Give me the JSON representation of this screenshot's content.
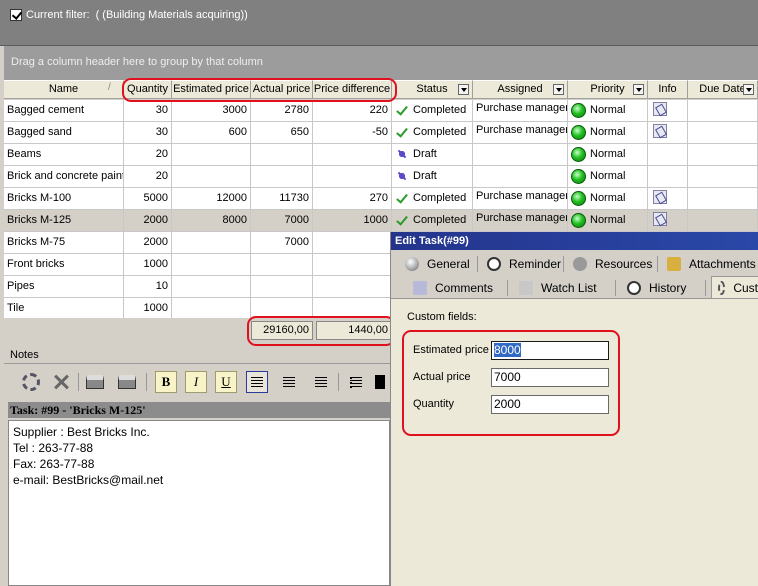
{
  "filter": {
    "label": "Current filter:",
    "value": "( (Building Materials acquiring))"
  },
  "group_panel": {
    "hint": "Drag a column header here to group by that column"
  },
  "grid": {
    "columns": [
      "Name",
      "Quantity",
      "Estimated price",
      "Actual price",
      "Price difference",
      "Status",
      "Assigned",
      "Priority",
      "Info",
      "Due Date"
    ],
    "rows": [
      {
        "name": "Bagged cement",
        "quantity": "30",
        "est": "3000",
        "actual": "2780",
        "diff": "220",
        "status": "Completed",
        "status_icon": "check-icon",
        "assigned": "Purchase manager",
        "priority": "Normal",
        "info": true
      },
      {
        "name": "Bagged sand",
        "quantity": "30",
        "est": "600",
        "actual": "650",
        "diff": "-50",
        "status": "Completed",
        "status_icon": "check-icon",
        "assigned": "Purchase manager",
        "priority": "Normal",
        "info": true
      },
      {
        "name": "Beams",
        "quantity": "20",
        "est": "",
        "actual": "",
        "diff": "",
        "status": "Draft",
        "status_icon": "draft-icon",
        "assigned": "",
        "priority": "Normal",
        "info": false
      },
      {
        "name": "Brick and concrete paint",
        "quantity": "20",
        "est": "",
        "actual": "",
        "diff": "",
        "status": "Draft",
        "status_icon": "draft-icon",
        "assigned": "",
        "priority": "Normal",
        "info": false
      },
      {
        "name": "Bricks M-100",
        "quantity": "5000",
        "est": "12000",
        "actual": "11730",
        "diff": "270",
        "status": "Completed",
        "status_icon": "check-icon",
        "assigned": "Purchase manager",
        "priority": "Normal",
        "info": true
      },
      {
        "name": "Bricks M-125",
        "quantity": "2000",
        "est": "8000",
        "actual": "7000",
        "diff": "1000",
        "status": "Completed",
        "status_icon": "check-icon",
        "assigned": "Purchase manager",
        "priority": "Normal",
        "info": true,
        "selected": true
      },
      {
        "name": "Bricks M-75",
        "quantity": "2000",
        "est": "",
        "actual": "7000",
        "diff": "",
        "status": "",
        "assigned": "",
        "priority": "",
        "info": false
      },
      {
        "name": "Front bricks",
        "quantity": "1000",
        "est": "",
        "actual": "",
        "diff": "",
        "status": "",
        "assigned": "",
        "priority": "",
        "info": false
      },
      {
        "name": "Pipes",
        "quantity": "10",
        "est": "",
        "actual": "",
        "diff": "",
        "status": "",
        "assigned": "",
        "priority": "",
        "info": false
      },
      {
        "name": "Tile",
        "quantity": "1000",
        "est": "",
        "actual": "",
        "diff": "",
        "status": "",
        "assigned": "",
        "priority": "",
        "info": false
      }
    ],
    "footer": {
      "actual_sum": "29160,00",
      "diff_sum": "1440,00"
    }
  },
  "notes": {
    "title": "Notes",
    "toolbar": {
      "bold": "B",
      "italic": "I",
      "underline": "U"
    },
    "task_header": "Task: #99 - 'Bricks M-125'",
    "lines": [
      "Supplier : Best Bricks Inc.",
      "Tel : 263-77-88",
      "Fax: 263-77-88",
      "e-mail: BestBricks@mail.net"
    ]
  },
  "dialog": {
    "title": "Edit Task(#99)",
    "tabs_row1": [
      "General",
      "Reminder",
      "Resources",
      "Attachments"
    ],
    "tabs_row2": [
      "Comments",
      "Watch List",
      "History",
      "Cust"
    ],
    "section_label": "Custom fields:",
    "fields": [
      {
        "label": "Estimated price",
        "value": "8000"
      },
      {
        "label": "Actual price",
        "value": "7000"
      },
      {
        "label": "Quantity",
        "value": "2000"
      }
    ]
  },
  "colors": {
    "highlight_box": "#e0101e",
    "selection": "#316ac5",
    "title_bar": "#24348c"
  }
}
